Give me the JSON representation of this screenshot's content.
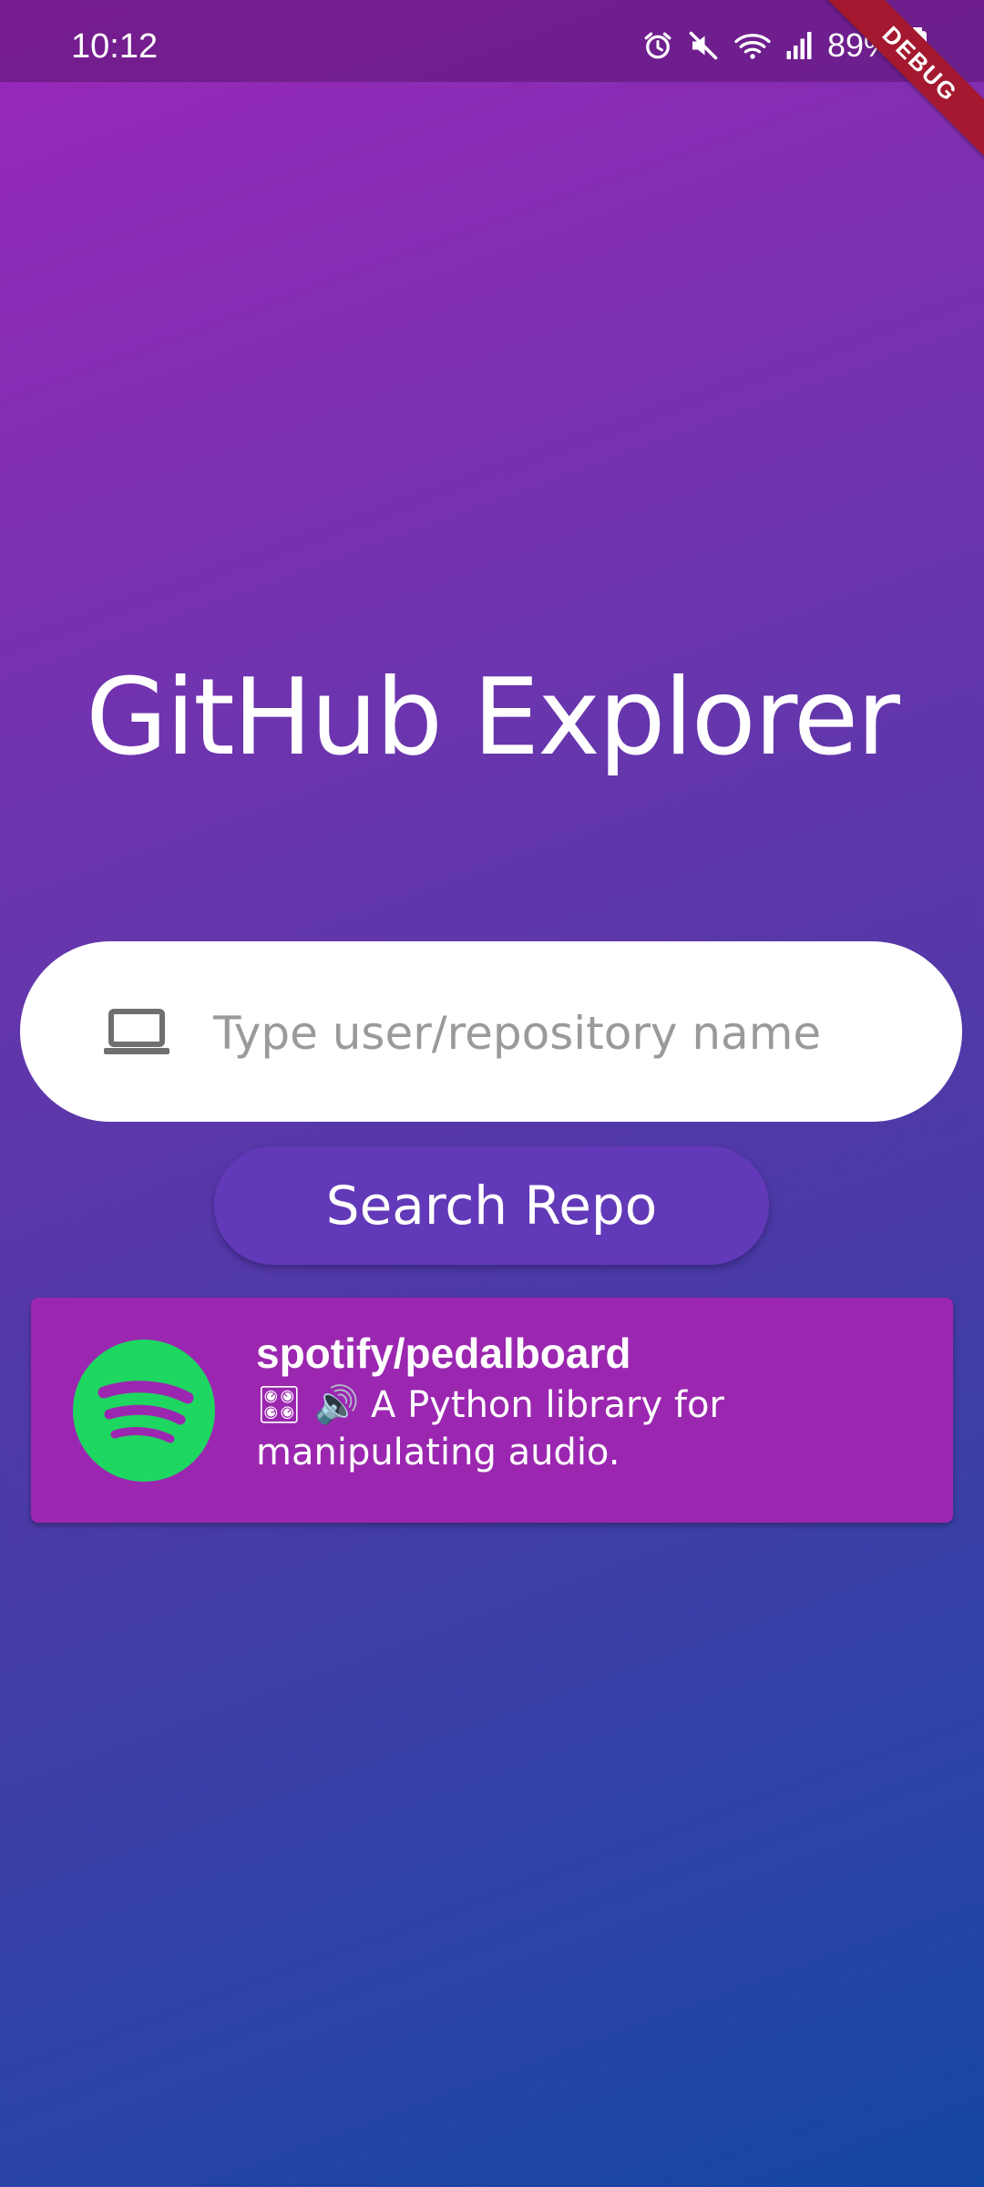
{
  "status_bar": {
    "time": "10:12",
    "battery": "89%",
    "icons": [
      "alarm-icon",
      "mute-icon",
      "wifi-icon",
      "signal-icon",
      "battery-charging-icon"
    ]
  },
  "debug_banner": "DEBUG",
  "app": {
    "title": "GitHub Explorer"
  },
  "search": {
    "placeholder": "Type user/repository name",
    "value": "",
    "icon": "laptop-icon",
    "button_label": "Search Repo"
  },
  "results": [
    {
      "name": "spotify/pedalboard",
      "description": "🎛 🔊 A Python library for manipulating audio.",
      "avatar": "spotify-logo"
    }
  ],
  "colors": {
    "gradient_top": "#9a27b9",
    "gradient_bottom": "#1446a3",
    "button": "#6239b8",
    "card": "#9b27b0",
    "spotify_green": "#1ed760"
  }
}
